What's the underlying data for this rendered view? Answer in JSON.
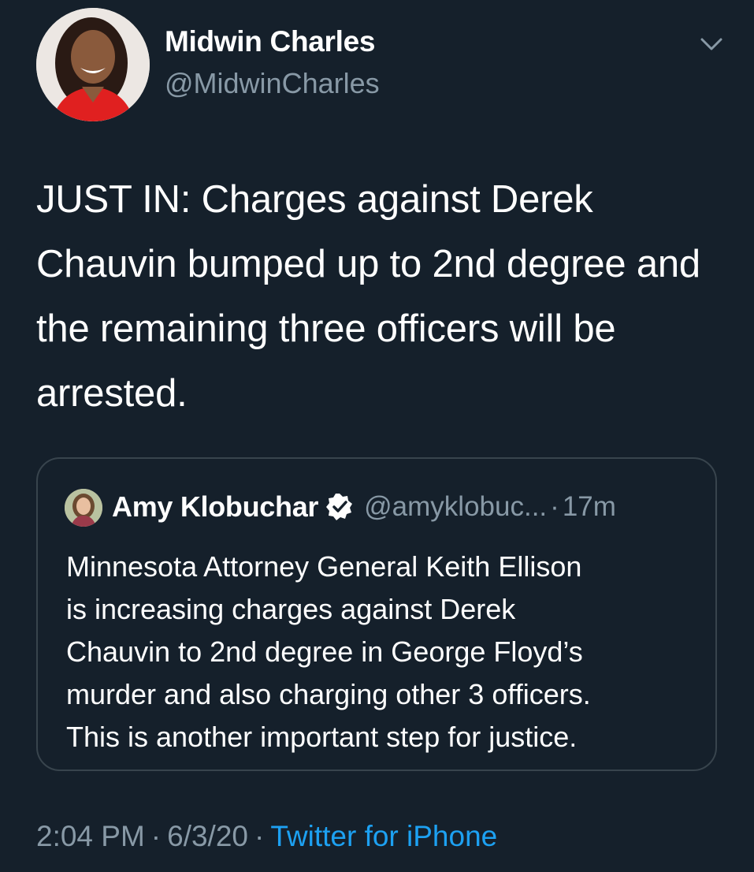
{
  "author": {
    "name": "Midwin Charles",
    "handle": "@MidwinCharles"
  },
  "tweet_text": "JUST IN: Charges against Derek Chauvin bumped up to 2nd degree and the remaining three officers will be arrested.",
  "quoted_tweet": {
    "name": "Amy Klobuchar",
    "handle": "@amyklobuc...",
    "dot": "·",
    "time": "17m",
    "verified": true,
    "text_lines": [
      "Minnesota Attorney General Keith Ellison",
      "is increasing charges against Derek",
      "Chauvin to 2nd degree in George Floyd’s",
      "murder and also charging other 3 officers.",
      "This is another important step for justice."
    ]
  },
  "meta": {
    "time": "2:04 PM",
    "sep1": "·",
    "date": "6/3/20",
    "sep2": "·",
    "source": "Twitter for iPhone"
  },
  "icons": {
    "menu": "chevron-down-icon",
    "verified": "verified-badge-icon"
  },
  "colors": {
    "background": "#15202b",
    "secondary_text": "#8899a6",
    "link": "#1da1f2",
    "border": "#38444d"
  }
}
